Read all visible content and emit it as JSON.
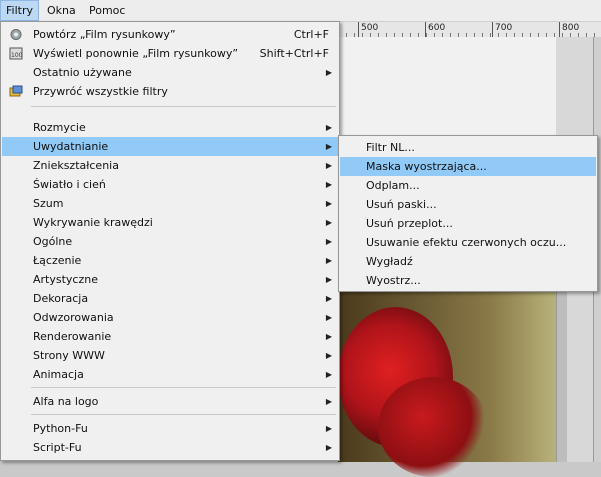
{
  "menubar": {
    "filtry": "Filtry",
    "okna": "Okna",
    "pomoc": "Pomoc"
  },
  "ruler": {
    "labels": [
      "500",
      "600",
      "700",
      "800",
      "900"
    ]
  },
  "filters_menu": {
    "repeat": {
      "label": "Powtórz „Film rysunkowy”",
      "shortcut": "Ctrl+F"
    },
    "reshow": {
      "label": "Wyświetl ponownie „Film rysunkowy”",
      "shortcut": "Shift+Ctrl+F"
    },
    "recent": "Ostatnio używane",
    "reset": "Przywróć wszystkie filtry",
    "items": [
      "Rozmycie",
      "Uwydatnianie",
      "Zniekształcenia",
      "Światło i cień",
      "Szum",
      "Wykrywanie krawędzi",
      "Ogólne",
      "Łączenie",
      "Artystyczne",
      "Dekoracja",
      "Odwzorowania",
      "Renderowanie",
      "Strony WWW",
      "Animacja"
    ],
    "alpha_to_logo": "Alfa na logo",
    "python_fu": "Python-Fu",
    "script_fu": "Script-Fu"
  },
  "enhance_submenu": {
    "items": [
      "Filtr NL...",
      "Maska wyostrzająca...",
      "Odplam...",
      "Usuń paski...",
      "Usuń przeplot...",
      "Usuwanie efektu czerwonych oczu...",
      "Wygładź",
      "Wyostrz..."
    ],
    "highlighted": "Maska wyostrzająca..."
  },
  "colors": {
    "highlight": "#91c9f7",
    "menu_bg": "#f0f0f0",
    "rose": "#b0141a"
  }
}
